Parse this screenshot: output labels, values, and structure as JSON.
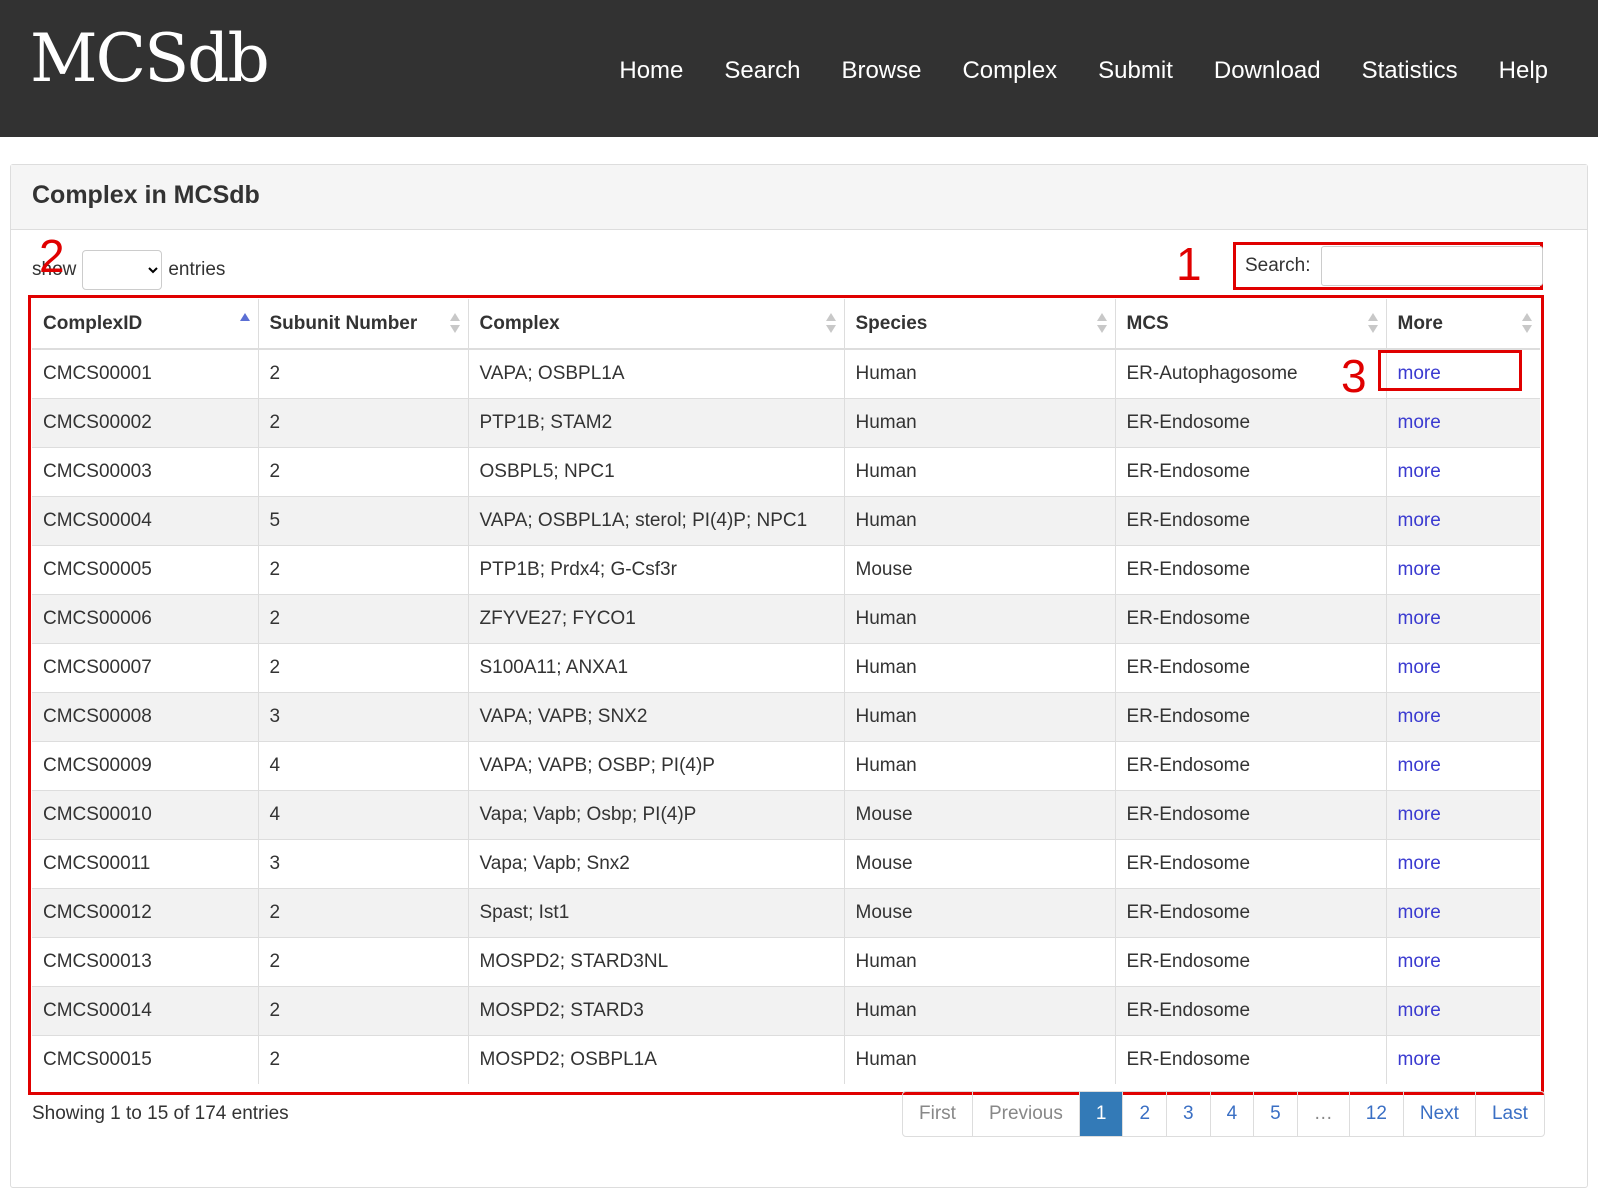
{
  "brand": "MCSdb",
  "nav": [
    "Home",
    "Search",
    "Browse",
    "Complex",
    "Submit",
    "Download",
    "Statistics",
    "Help"
  ],
  "panel_title": "Complex in MCSdb",
  "length": {
    "show": "show",
    "entries": "entries",
    "value": ""
  },
  "search": {
    "label": "Search:",
    "value": ""
  },
  "annotations": [
    "1",
    "2",
    "3"
  ],
  "columns": [
    "ComplexID",
    "Subunit Number",
    "Complex",
    "Species",
    "MCS",
    "More"
  ],
  "rows": [
    [
      "CMCS00001",
      "2",
      "VAPA; OSBPL1A",
      "Human",
      "ER-Autophagosome",
      "more"
    ],
    [
      "CMCS00002",
      "2",
      "PTP1B; STAM2",
      "Human",
      "ER-Endosome",
      "more"
    ],
    [
      "CMCS00003",
      "2",
      "OSBPL5; NPC1",
      "Human",
      "ER-Endosome",
      "more"
    ],
    [
      "CMCS00004",
      "5",
      "VAPA; OSBPL1A; sterol; PI(4)P; NPC1",
      "Human",
      "ER-Endosome",
      "more"
    ],
    [
      "CMCS00005",
      "2",
      "PTP1B; Prdx4; G-Csf3r",
      "Mouse",
      "ER-Endosome",
      "more"
    ],
    [
      "CMCS00006",
      "2",
      "ZFYVE27; FYCO1",
      "Human",
      "ER-Endosome",
      "more"
    ],
    [
      "CMCS00007",
      "2",
      "S100A11; ANXA1",
      "Human",
      "ER-Endosome",
      "more"
    ],
    [
      "CMCS00008",
      "3",
      "VAPA; VAPB; SNX2",
      "Human",
      "ER-Endosome",
      "more"
    ],
    [
      "CMCS00009",
      "4",
      "VAPA; VAPB; OSBP; PI(4)P",
      "Human",
      "ER-Endosome",
      "more"
    ],
    [
      "CMCS00010",
      "4",
      "Vapa; Vapb; Osbp; PI(4)P",
      "Mouse",
      "ER-Endosome",
      "more"
    ],
    [
      "CMCS00011",
      "3",
      "Vapa; Vapb; Snx2",
      "Mouse",
      "ER-Endosome",
      "more"
    ],
    [
      "CMCS00012",
      "2",
      "Spast; Ist1",
      "Mouse",
      "ER-Endosome",
      "more"
    ],
    [
      "CMCS00013",
      "2",
      "MOSPD2; STARD3NL",
      "Human",
      "ER-Endosome",
      "more"
    ],
    [
      "CMCS00014",
      "2",
      "MOSPD2; STARD3",
      "Human",
      "ER-Endosome",
      "more"
    ],
    [
      "CMCS00015",
      "2",
      "MOSPD2; OSBPL1A",
      "Human",
      "ER-Endosome",
      "more"
    ]
  ],
  "info": "Showing 1 to 15 of 174 entries",
  "pagination": [
    "First",
    "Previous",
    "1",
    "2",
    "3",
    "4",
    "5",
    "…",
    "12",
    "Next",
    "Last"
  ],
  "pagination_active": "1",
  "colors": {
    "navbar": "#323232",
    "annotation": "#e00000",
    "link": "#3a3ad0",
    "active_page": "#337ab7"
  }
}
